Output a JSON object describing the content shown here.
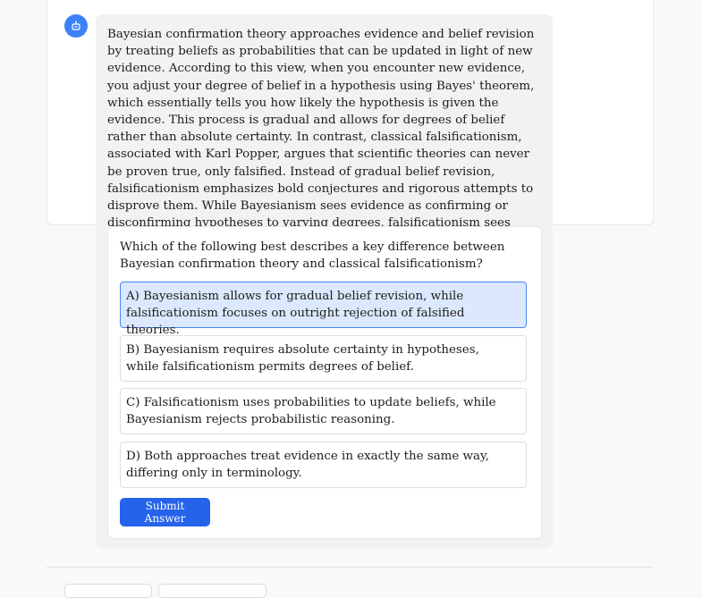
{
  "message": {
    "text": "Bayesian confirmation theory approaches evidence and belief revision by treating beliefs as probabilities that can be updated in light of new evidence. According to this view, when you encounter new evidence, you adjust your degree of belief in a hypothesis using Bayes' theorem, which essentially tells you how likely the hypothesis is given the evidence. This process is gradual and allows for degrees of belief rather than absolute certainty. In contrast, classical falsificationism, associated with Karl Popper, argues that scientific theories can never be proven true, only falsified. Instead of gradual belief revision, falsificationism emphasizes bold conjectures and rigorous attempts to disprove them. While Bayesianism sees evidence as confirming or disconfirming hypotheses to varying degrees, falsificationism sees evidence primarily as a tool for rejecting false theories outright."
  },
  "quiz": {
    "question": "Which of the following best describes a key difference between Bayesian confirmation theory and classical falsificationism?",
    "options": [
      {
        "label": "A) Bayesianism allows for gradual belief revision, while falsificationism focuses on outright rejection of falsified theories.",
        "selected": true
      },
      {
        "label": "B) Bayesianism requires absolute certainty in hypotheses, while falsificationism permits degrees of belief.",
        "selected": false
      },
      {
        "label": "C) Falsificationism uses probabilities to update beliefs, while Bayesianism rejects probabilistic reasoning.",
        "selected": false
      },
      {
        "label": "D) Both approaches treat evidence in exactly the same way, differing only in terminology.",
        "selected": false
      }
    ],
    "submit_label": "Submit Answer"
  },
  "colors": {
    "accent": "#2563eb",
    "selected_bg": "#dbe8fd",
    "selected_border": "#4a86f0",
    "bubble_bg": "#f1f2f4"
  },
  "icons": {
    "avatar": "bot-icon"
  }
}
